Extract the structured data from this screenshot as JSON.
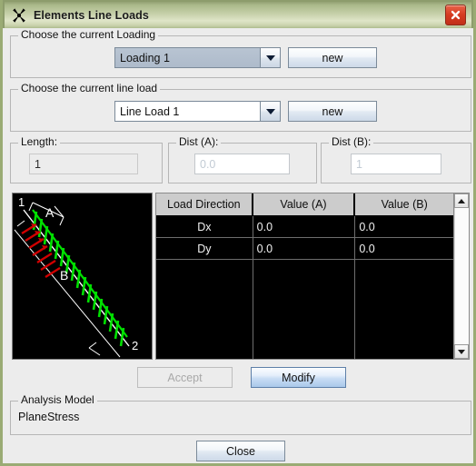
{
  "window": {
    "title": "Elements Line Loads",
    "icon": "windmill-icon",
    "close_icon": "close-icon",
    "border_color": "#9aab74",
    "titlebar_color": "#c6d0a9"
  },
  "loading_group": {
    "title": "Choose the current Loading",
    "combo_value": "Loading 1",
    "combo_arrow_icon": "chevron-down-icon",
    "new_label": "new"
  },
  "lineload_group": {
    "title": "Choose the current line load",
    "combo_value": "Line Load 1",
    "combo_arrow_icon": "chevron-down-icon",
    "new_label": "new"
  },
  "length_group": {
    "title": "Length:",
    "value": "1"
  },
  "dist_a_group": {
    "title": "Dist (A):",
    "value": "0.0"
  },
  "dist_b_group": {
    "title": "Dist (B):",
    "value": "1"
  },
  "model_view": {
    "node_start_label": "1",
    "node_end_label": "2",
    "dim_a_label": "A",
    "dim_b_label": "B",
    "background": "#000000",
    "member_color": "#ffffff",
    "load_color": "#00e000",
    "secondary_load_color": "#d00000"
  },
  "table": {
    "columns": [
      "Load Direction",
      "Value (A)",
      "Value (B)"
    ],
    "rows": [
      [
        "Dx",
        "0.0",
        "0.0"
      ],
      [
        "Dy",
        "0.0",
        "0.0"
      ]
    ],
    "scroll_up_icon": "triangle-up-icon",
    "scroll_down_icon": "triangle-down-icon"
  },
  "actions": {
    "accept_label": "Accept",
    "accept_enabled": false,
    "modify_label": "Modify",
    "modify_enabled": true
  },
  "analysis_group": {
    "title": "Analysis Model",
    "value": "PlaneStress"
  },
  "footer": {
    "close_label": "Close"
  }
}
